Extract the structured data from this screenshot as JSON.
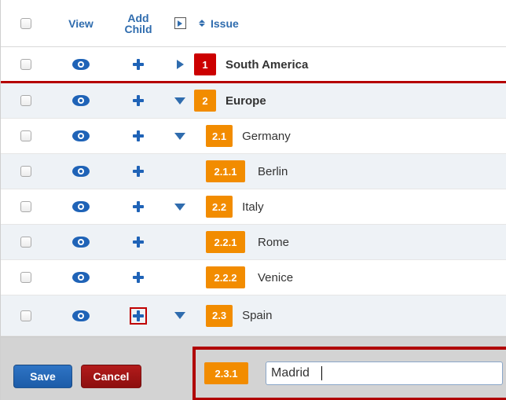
{
  "header": {
    "view": "View",
    "add_child": "Add\nChild",
    "issue": "Issue"
  },
  "rows": [
    {
      "badge": "1",
      "title": "South America"
    },
    {
      "badge": "2",
      "title": "Europe"
    },
    {
      "badge": "2.1",
      "title": "Germany"
    },
    {
      "badge": "2.1.1",
      "title": "Berlin"
    },
    {
      "badge": "2.2",
      "title": "Italy"
    },
    {
      "badge": "2.2.1",
      "title": "Rome"
    },
    {
      "badge": "2.2.2",
      "title": "Venice"
    },
    {
      "badge": "2.3",
      "title": "Spain"
    }
  ],
  "footer": {
    "save": "Save",
    "cancel": "Cancel",
    "new_badge": "2.3.1",
    "new_value": "Madrid"
  },
  "icons": {
    "view": "eye-icon",
    "add_child": "plus-icon",
    "expand_collapsed": "triangle-right-icon",
    "expand_open": "triangle-down-icon",
    "sort": "sort-icon"
  },
  "colors": {
    "accent_blue": "#2f6cae",
    "badge_red": "#cc0000",
    "badge_orange": "#f28c00",
    "highlight_red": "#b50000",
    "shaded_row": "#eef2f6",
    "footer_bg": "#d3d3d3"
  }
}
